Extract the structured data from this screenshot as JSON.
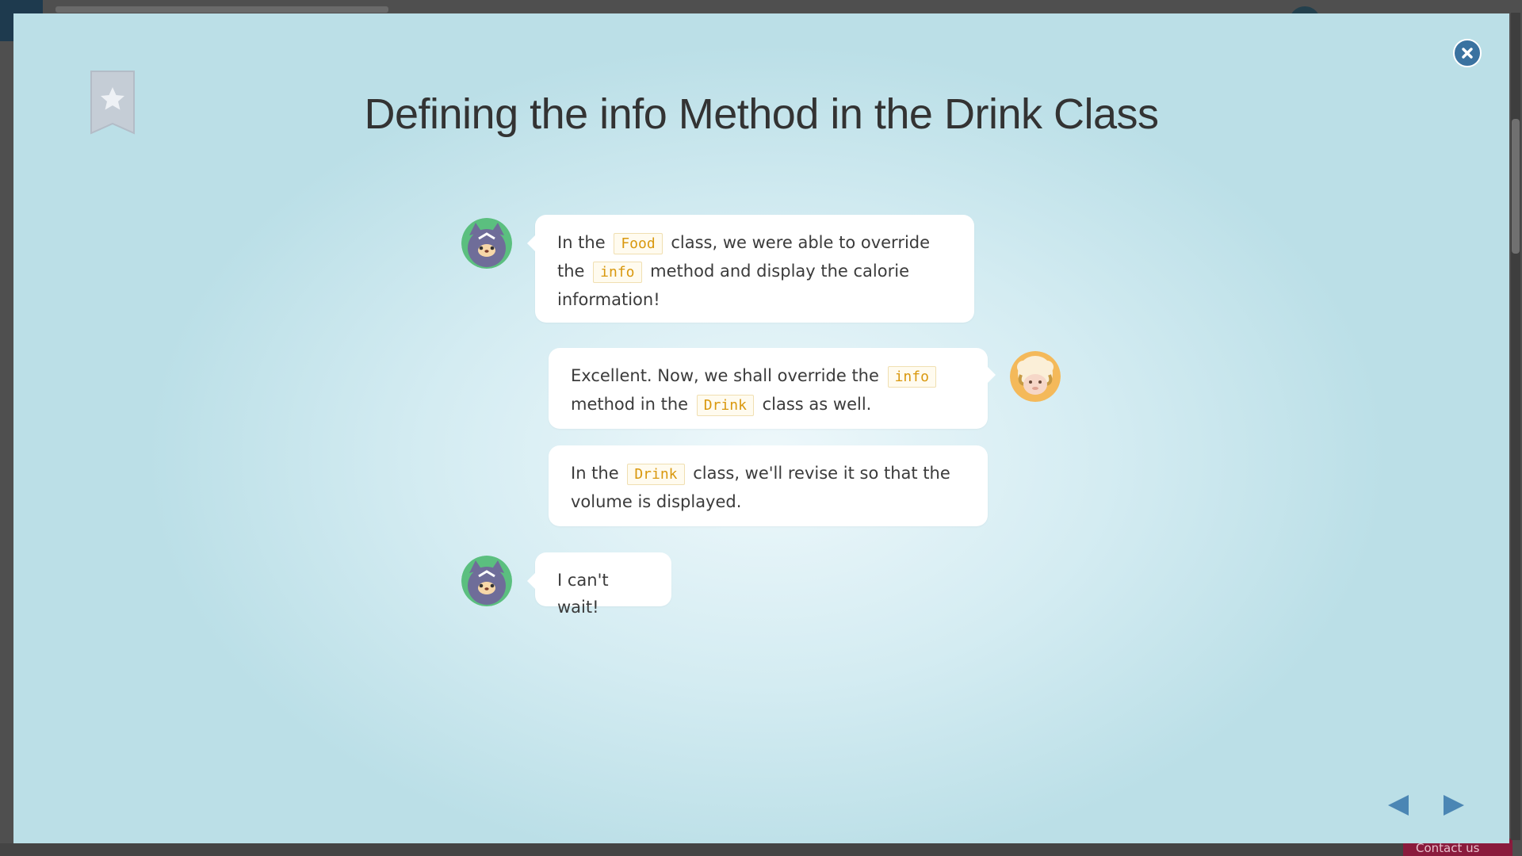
{
  "page": {
    "title": "Defining the info Method in the Drink Class",
    "contact_label": "Contact us"
  },
  "colors": {
    "accent": "#3a72a0",
    "code_text": "#d9980e",
    "bookmark": "#c5cdd6"
  },
  "icons": {
    "close": "close-icon",
    "bookmark": "bookmark-star-icon",
    "prev": "triangle-left-icon",
    "next": "triangle-right-icon"
  },
  "chat": {
    "messages": [
      {
        "speaker": "cat",
        "parts": [
          "In the ",
          "Food",
          " class, we were able to override the ",
          "info",
          " method and display the calorie information!"
        ]
      },
      {
        "speaker": "sheep",
        "parts": [
          "Excellent. Now, we shall override the ",
          "info",
          " method in the ",
          "Drink",
          " class as well."
        ]
      },
      {
        "speaker": "sheep",
        "parts": [
          "In the ",
          "Drink",
          " class, we'll revise it so that the volume is displayed."
        ]
      },
      {
        "speaker": "cat",
        "parts": [
          "I can't wait!"
        ]
      }
    ]
  }
}
